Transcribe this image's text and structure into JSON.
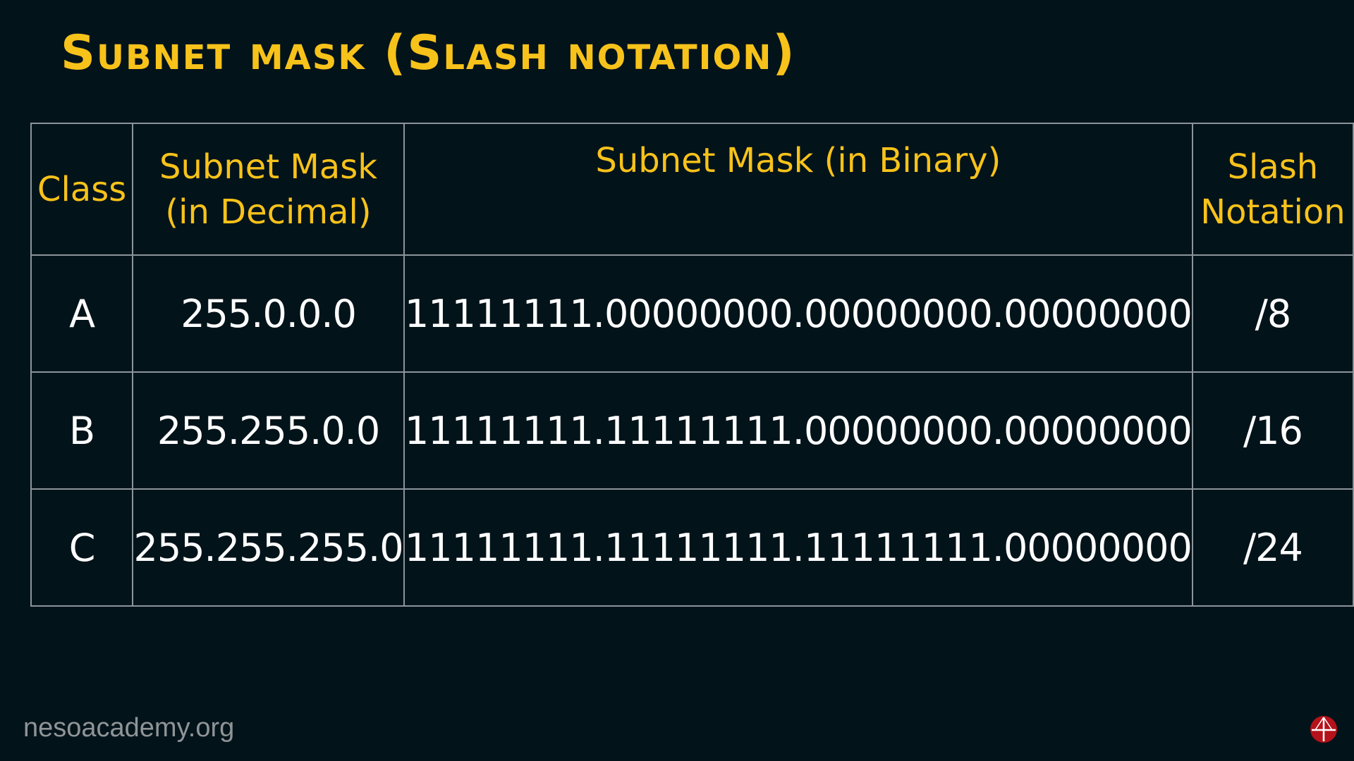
{
  "title": "Subnet mask (Slash notation)",
  "table": {
    "headers": [
      "Class",
      "Subnet Mask (in Decimal)",
      "Subnet Mask (in Binary)",
      "Slash Notation"
    ],
    "header_lines": {
      "decimal": [
        "Subnet Mask",
        "(in Decimal)"
      ],
      "slash": [
        "Slash",
        "Notation"
      ]
    },
    "rows": [
      {
        "class": "A",
        "decimal": "255.0.0.0",
        "binary": "11111111.00000000.00000000.00000000",
        "slash": "/8"
      },
      {
        "class": "B",
        "decimal": "255.255.0.0",
        "binary": "11111111.11111111.00000000.00000000",
        "slash": "/16"
      },
      {
        "class": "C",
        "decimal": "255.255.255.0",
        "binary": "11111111.11111111.11111111.00000000",
        "slash": "/24"
      }
    ]
  },
  "footer": "nesoacademy.org",
  "colors": {
    "background": "#03131a",
    "accent": "#f7c21a",
    "text": "#ffffff",
    "logo": "#b5121b"
  },
  "icons": {
    "logo": "neso-academy-logo"
  }
}
